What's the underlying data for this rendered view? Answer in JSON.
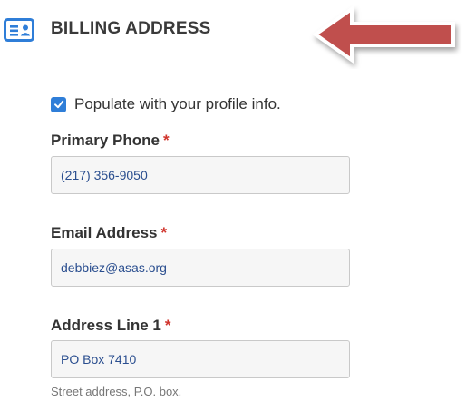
{
  "header": {
    "title": "BILLING ADDRESS",
    "icon": "address-card-icon",
    "accent_color": "#2f7ed8"
  },
  "annotation": {
    "icon": "red-arrow-pointer",
    "color": "#c0504d"
  },
  "profile_checkbox": {
    "checked": true,
    "label": "Populate with your profile info."
  },
  "fields": {
    "primary_phone": {
      "label": "Primary Phone",
      "required_mark": "*",
      "value": "(217) 356-9050"
    },
    "email_address": {
      "label": "Email Address",
      "required_mark": "*",
      "value": "debbiez@asas.org"
    },
    "address_line_1": {
      "label": "Address Line 1",
      "required_mark": "*",
      "value": "PO Box 7410",
      "hint": "Street address, P.O. box."
    }
  }
}
